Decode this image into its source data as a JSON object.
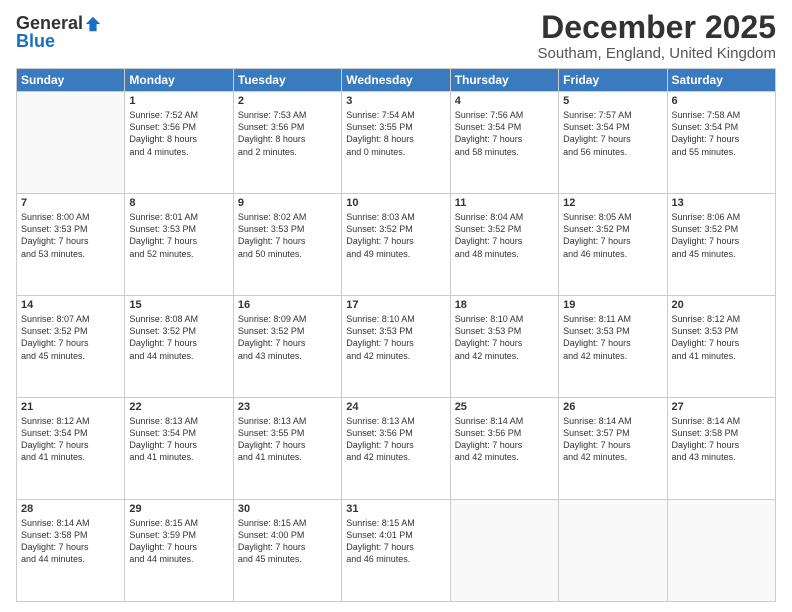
{
  "header": {
    "logo_line1": "General",
    "logo_line2": "Blue",
    "month": "December 2025",
    "location": "Southam, England, United Kingdom"
  },
  "weekdays": [
    "Sunday",
    "Monday",
    "Tuesday",
    "Wednesday",
    "Thursday",
    "Friday",
    "Saturday"
  ],
  "weeks": [
    [
      {
        "day": "",
        "info": ""
      },
      {
        "day": "1",
        "info": "Sunrise: 7:52 AM\nSunset: 3:56 PM\nDaylight: 8 hours\nand 4 minutes."
      },
      {
        "day": "2",
        "info": "Sunrise: 7:53 AM\nSunset: 3:56 PM\nDaylight: 8 hours\nand 2 minutes."
      },
      {
        "day": "3",
        "info": "Sunrise: 7:54 AM\nSunset: 3:55 PM\nDaylight: 8 hours\nand 0 minutes."
      },
      {
        "day": "4",
        "info": "Sunrise: 7:56 AM\nSunset: 3:54 PM\nDaylight: 7 hours\nand 58 minutes."
      },
      {
        "day": "5",
        "info": "Sunrise: 7:57 AM\nSunset: 3:54 PM\nDaylight: 7 hours\nand 56 minutes."
      },
      {
        "day": "6",
        "info": "Sunrise: 7:58 AM\nSunset: 3:54 PM\nDaylight: 7 hours\nand 55 minutes."
      }
    ],
    [
      {
        "day": "7",
        "info": "Sunrise: 8:00 AM\nSunset: 3:53 PM\nDaylight: 7 hours\nand 53 minutes."
      },
      {
        "day": "8",
        "info": "Sunrise: 8:01 AM\nSunset: 3:53 PM\nDaylight: 7 hours\nand 52 minutes."
      },
      {
        "day": "9",
        "info": "Sunrise: 8:02 AM\nSunset: 3:53 PM\nDaylight: 7 hours\nand 50 minutes."
      },
      {
        "day": "10",
        "info": "Sunrise: 8:03 AM\nSunset: 3:52 PM\nDaylight: 7 hours\nand 49 minutes."
      },
      {
        "day": "11",
        "info": "Sunrise: 8:04 AM\nSunset: 3:52 PM\nDaylight: 7 hours\nand 48 minutes."
      },
      {
        "day": "12",
        "info": "Sunrise: 8:05 AM\nSunset: 3:52 PM\nDaylight: 7 hours\nand 46 minutes."
      },
      {
        "day": "13",
        "info": "Sunrise: 8:06 AM\nSunset: 3:52 PM\nDaylight: 7 hours\nand 45 minutes."
      }
    ],
    [
      {
        "day": "14",
        "info": "Sunrise: 8:07 AM\nSunset: 3:52 PM\nDaylight: 7 hours\nand 45 minutes."
      },
      {
        "day": "15",
        "info": "Sunrise: 8:08 AM\nSunset: 3:52 PM\nDaylight: 7 hours\nand 44 minutes."
      },
      {
        "day": "16",
        "info": "Sunrise: 8:09 AM\nSunset: 3:52 PM\nDaylight: 7 hours\nand 43 minutes."
      },
      {
        "day": "17",
        "info": "Sunrise: 8:10 AM\nSunset: 3:53 PM\nDaylight: 7 hours\nand 42 minutes."
      },
      {
        "day": "18",
        "info": "Sunrise: 8:10 AM\nSunset: 3:53 PM\nDaylight: 7 hours\nand 42 minutes."
      },
      {
        "day": "19",
        "info": "Sunrise: 8:11 AM\nSunset: 3:53 PM\nDaylight: 7 hours\nand 42 minutes."
      },
      {
        "day": "20",
        "info": "Sunrise: 8:12 AM\nSunset: 3:53 PM\nDaylight: 7 hours\nand 41 minutes."
      }
    ],
    [
      {
        "day": "21",
        "info": "Sunrise: 8:12 AM\nSunset: 3:54 PM\nDaylight: 7 hours\nand 41 minutes."
      },
      {
        "day": "22",
        "info": "Sunrise: 8:13 AM\nSunset: 3:54 PM\nDaylight: 7 hours\nand 41 minutes."
      },
      {
        "day": "23",
        "info": "Sunrise: 8:13 AM\nSunset: 3:55 PM\nDaylight: 7 hours\nand 41 minutes."
      },
      {
        "day": "24",
        "info": "Sunrise: 8:13 AM\nSunset: 3:56 PM\nDaylight: 7 hours\nand 42 minutes."
      },
      {
        "day": "25",
        "info": "Sunrise: 8:14 AM\nSunset: 3:56 PM\nDaylight: 7 hours\nand 42 minutes."
      },
      {
        "day": "26",
        "info": "Sunrise: 8:14 AM\nSunset: 3:57 PM\nDaylight: 7 hours\nand 42 minutes."
      },
      {
        "day": "27",
        "info": "Sunrise: 8:14 AM\nSunset: 3:58 PM\nDaylight: 7 hours\nand 43 minutes."
      }
    ],
    [
      {
        "day": "28",
        "info": "Sunrise: 8:14 AM\nSunset: 3:58 PM\nDaylight: 7 hours\nand 44 minutes."
      },
      {
        "day": "29",
        "info": "Sunrise: 8:15 AM\nSunset: 3:59 PM\nDaylight: 7 hours\nand 44 minutes."
      },
      {
        "day": "30",
        "info": "Sunrise: 8:15 AM\nSunset: 4:00 PM\nDaylight: 7 hours\nand 45 minutes."
      },
      {
        "day": "31",
        "info": "Sunrise: 8:15 AM\nSunset: 4:01 PM\nDaylight: 7 hours\nand 46 minutes."
      },
      {
        "day": "",
        "info": ""
      },
      {
        "day": "",
        "info": ""
      },
      {
        "day": "",
        "info": ""
      }
    ]
  ]
}
